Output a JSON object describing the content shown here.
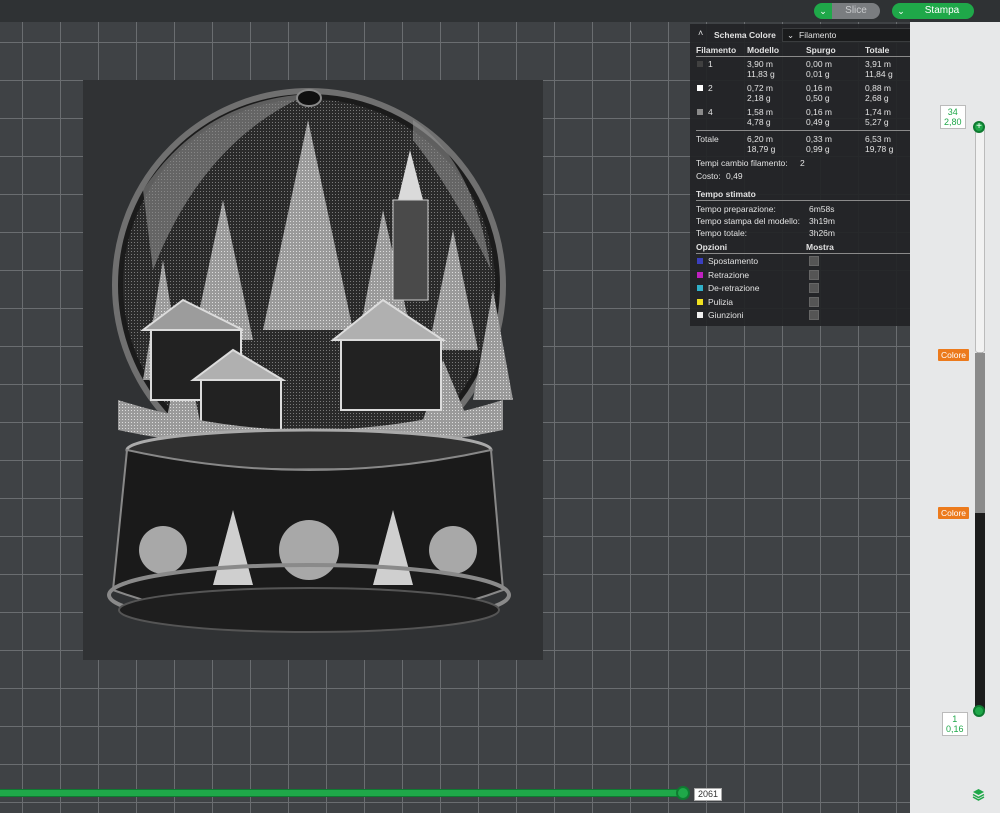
{
  "toolbar": {
    "slice_label": "Slice",
    "print_label": "Stampa",
    "accent": "#1fa849"
  },
  "legend": {
    "title": "Schema Colore",
    "mode": "Filamento",
    "headers": [
      "Filamento",
      "Modello",
      "Spurgo",
      "Totale"
    ],
    "rows": [
      {
        "id": "1",
        "color": "#404040",
        "model_m": "3,90 m",
        "model_g": "11,83 g",
        "purge_m": "0,00 m",
        "purge_g": "0,01 g",
        "total_m": "3,91 m",
        "total_g": "11,84 g"
      },
      {
        "id": "2",
        "color": "#ffffff",
        "model_m": "0,72 m",
        "model_g": "2,18 g",
        "purge_m": "0,16 m",
        "purge_g": "0,50 g",
        "total_m": "0,88 m",
        "total_g": "2,68 g"
      },
      {
        "id": "4",
        "color": "#8a8a8a",
        "model_m": "1,58 m",
        "model_g": "4,78 g",
        "purge_m": "0,16 m",
        "purge_g": "0,49 g",
        "total_m": "1,74 m",
        "total_g": "5,27 g"
      }
    ],
    "totals": {
      "label": "Totale",
      "model_m": "6,20 m",
      "model_g": "18,79 g",
      "purge_m": "0,33 m",
      "purge_g": "0,99 g",
      "total_m": "6,53 m",
      "total_g": "19,78 g"
    },
    "changes_label": "Tempi cambio filamento:",
    "changes_value": "2",
    "cost_label": "Costo:",
    "cost_value": "0,49",
    "time_title": "Tempo stimato",
    "times": [
      {
        "label": "Tempo preparazione:",
        "value": "6m58s"
      },
      {
        "label": "Tempo stampa del modello:",
        "value": "3h19m"
      },
      {
        "label": "Tempo totale:",
        "value": "3h26m"
      }
    ],
    "options_header": "Opzioni",
    "show_header": "Mostra",
    "options": [
      {
        "label": "Spostamento",
        "color": "#3b3fbf"
      },
      {
        "label": "Retrazione",
        "color": "#c020c0"
      },
      {
        "label": "De-retrazione",
        "color": "#30b0c8"
      },
      {
        "label": "Pulizia",
        "color": "#f0e020"
      },
      {
        "label": "Giunzioni",
        "color": "#f0f0f0"
      }
    ]
  },
  "layer_slider": {
    "top_layer": "34",
    "top_height": "2,80",
    "bottom_layer": "1",
    "bottom_height": "0,16",
    "color_change_tag_1": "Colore",
    "color_change_tag_2": "Colore"
  },
  "move_slider": {
    "value": "2061"
  },
  "icons": {
    "toggle": "chevron-down-icon",
    "collapse": "double-chevron-up-icon",
    "layers": "layers-icon"
  }
}
